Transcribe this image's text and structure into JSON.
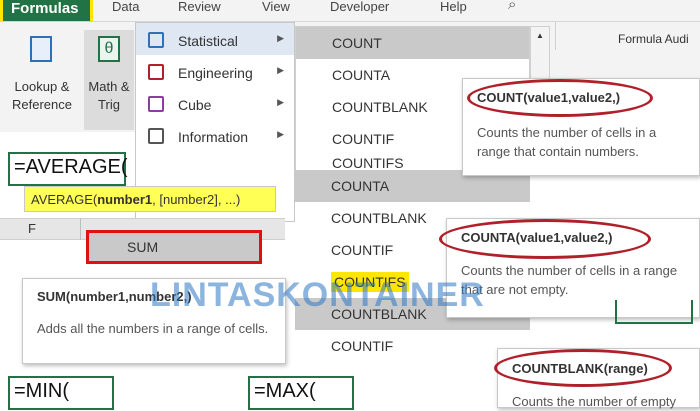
{
  "ribbon": {
    "tabs": [
      "Formulas",
      "Data",
      "Review",
      "View",
      "Developer",
      "Help"
    ],
    "lookup_label": [
      "Lookup &",
      "Reference"
    ],
    "math_label": [
      "Math &",
      "Trig"
    ],
    "group_label": "Formula Audi",
    "f_column": "F"
  },
  "category_menu": {
    "items": [
      "Statistical",
      "Engineering",
      "Cube",
      "Information"
    ]
  },
  "count_list": {
    "items": [
      "COUNT",
      "COUNTA",
      "COUNTBLANK",
      "COUNTIF",
      "COUNTIFS"
    ]
  },
  "count_list_2": {
    "items": [
      "COUNTA",
      "COUNTBLANK",
      "COUNTIF",
      "COUNTIFS",
      "COUNTBLANK",
      "COUNTIF"
    ]
  },
  "tooltips": {
    "count": {
      "sig": "COUNT(value1,value2,)",
      "desc": "Counts the number of cells in a range that contain numbers."
    },
    "counta": {
      "sig": "COUNTA(value1,value2,)",
      "desc": "Counts the number of cells in a range that are not empty."
    },
    "countblank": {
      "sig": "COUNTBLANK(range)",
      "desc": "Counts the number of empty"
    },
    "sum": {
      "sig": "SUM(number1,number2,)",
      "desc": "Adds all the numbers in a range of cells."
    }
  },
  "formulas": {
    "average": "=AVERAGE(",
    "average_hint_fn": "AVERAGE(",
    "average_hint_arg": "number1",
    "average_hint_rest": ", [number2], ...)",
    "min": "=MIN(",
    "max": "=MAX(",
    "sum_item": "SUM"
  },
  "watermark": "LINTASKONTAINER",
  "colors": {
    "accent": "#217346",
    "highlight": "#ffe600",
    "oval": "#b0202a"
  }
}
